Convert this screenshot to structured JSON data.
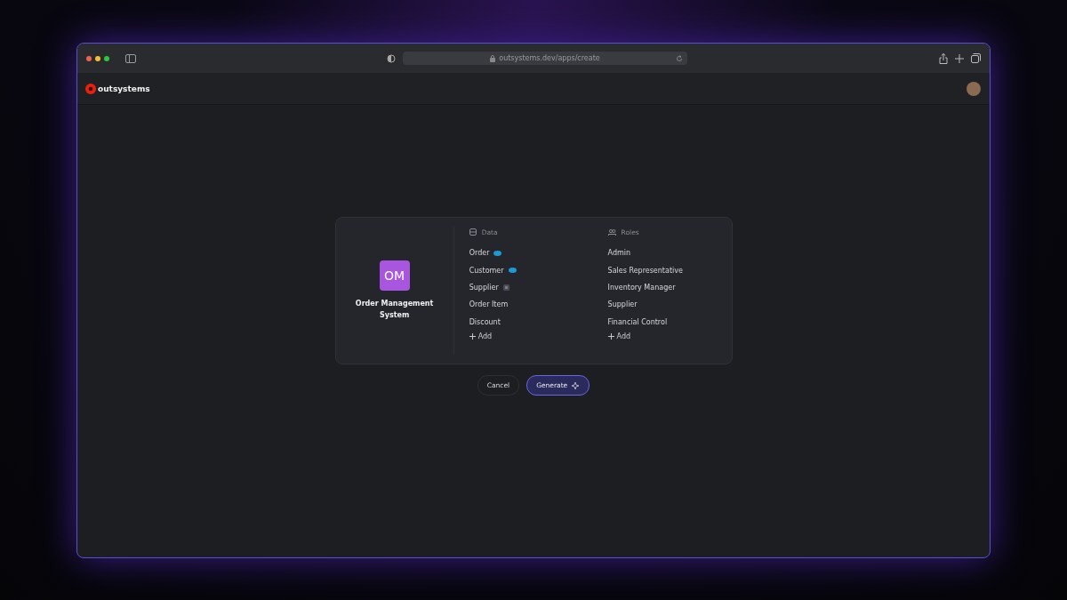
{
  "browser": {
    "url": "outsystems.dev/apps/create"
  },
  "header": {
    "logo_text": "outsystems"
  },
  "app": {
    "initials": "OM",
    "name": "Order Management System"
  },
  "data": {
    "heading": "Data",
    "items": [
      {
        "label": "Order",
        "kind": "cloud"
      },
      {
        "label": "Customer",
        "kind": "cloud"
      },
      {
        "label": "Supplier",
        "kind": "local"
      },
      {
        "label": "Order Item",
        "kind": "plain"
      },
      {
        "label": "Discount",
        "kind": "plain"
      }
    ],
    "add": "Add"
  },
  "roles": {
    "heading": "Roles",
    "items": [
      "Admin",
      "Sales Representative",
      "Inventory Manager",
      "Supplier",
      "Financial Control"
    ],
    "add": "Add"
  },
  "buttons": {
    "cancel": "Cancel",
    "generate": "Generate"
  }
}
